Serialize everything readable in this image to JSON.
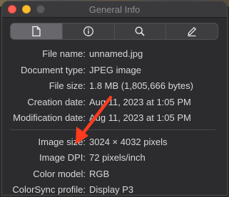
{
  "window": {
    "title": "General Info"
  },
  "toolbar": {
    "tabs": [
      {
        "icon": "document-icon",
        "selected": true
      },
      {
        "icon": "info-icon",
        "selected": false
      },
      {
        "icon": "magnifier-icon",
        "selected": false
      },
      {
        "icon": "pencil-icon",
        "selected": false
      }
    ]
  },
  "info": {
    "file_name": {
      "label": "File name:",
      "value": "unnamed.jpg"
    },
    "document_type": {
      "label": "Document type:",
      "value": "JPEG image"
    },
    "file_size": {
      "label": "File size:",
      "value": "1.8 MB (1,805,666 bytes)"
    },
    "creation_date": {
      "label": "Creation date:",
      "value": "Aug 11, 2023 at 1:05 PM"
    },
    "modification_date": {
      "label": "Modification date:",
      "value": "Aug 11, 2023 at 1:05 PM"
    },
    "image_size": {
      "label": "Image size:",
      "value": "3024 × 4032 pixels"
    },
    "image_dpi": {
      "label": "Image DPI:",
      "value": "72 pixels/inch"
    },
    "color_model": {
      "label": "Color model:",
      "value": "RGB"
    },
    "colorsync_profile": {
      "label": "ColorSync profile:",
      "value": "Display P3"
    }
  },
  "annotation": {
    "type": "arrow",
    "color": "#ff3b1f"
  }
}
